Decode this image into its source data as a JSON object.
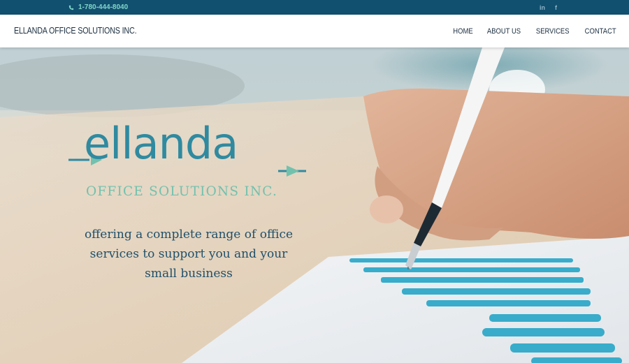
{
  "topbar": {
    "phone": "1-780-444-8040",
    "social": [
      {
        "icon": "linkedin-icon",
        "label": "in"
      },
      {
        "icon": "facebook-icon",
        "label": "f"
      }
    ]
  },
  "navbar": {
    "brand": "ELLANDA OFFICE SOLUTIONS INC.",
    "links": [
      "HOME",
      "ABOUT US",
      "SERVICES",
      "CONTACT"
    ]
  },
  "hero": {
    "logo_word": "ellanda",
    "logo_sub": "OFFICE SOLUTIONS INC.",
    "tagline": "offering a complete range of office services to support you and your small business"
  },
  "colors": {
    "topbar_bg": "#12506f",
    "phone_text": "#7fd6c8",
    "logo_teal": "#2f8aa0",
    "logo_mint": "#72c1ad",
    "tagline_text": "#20506a"
  }
}
